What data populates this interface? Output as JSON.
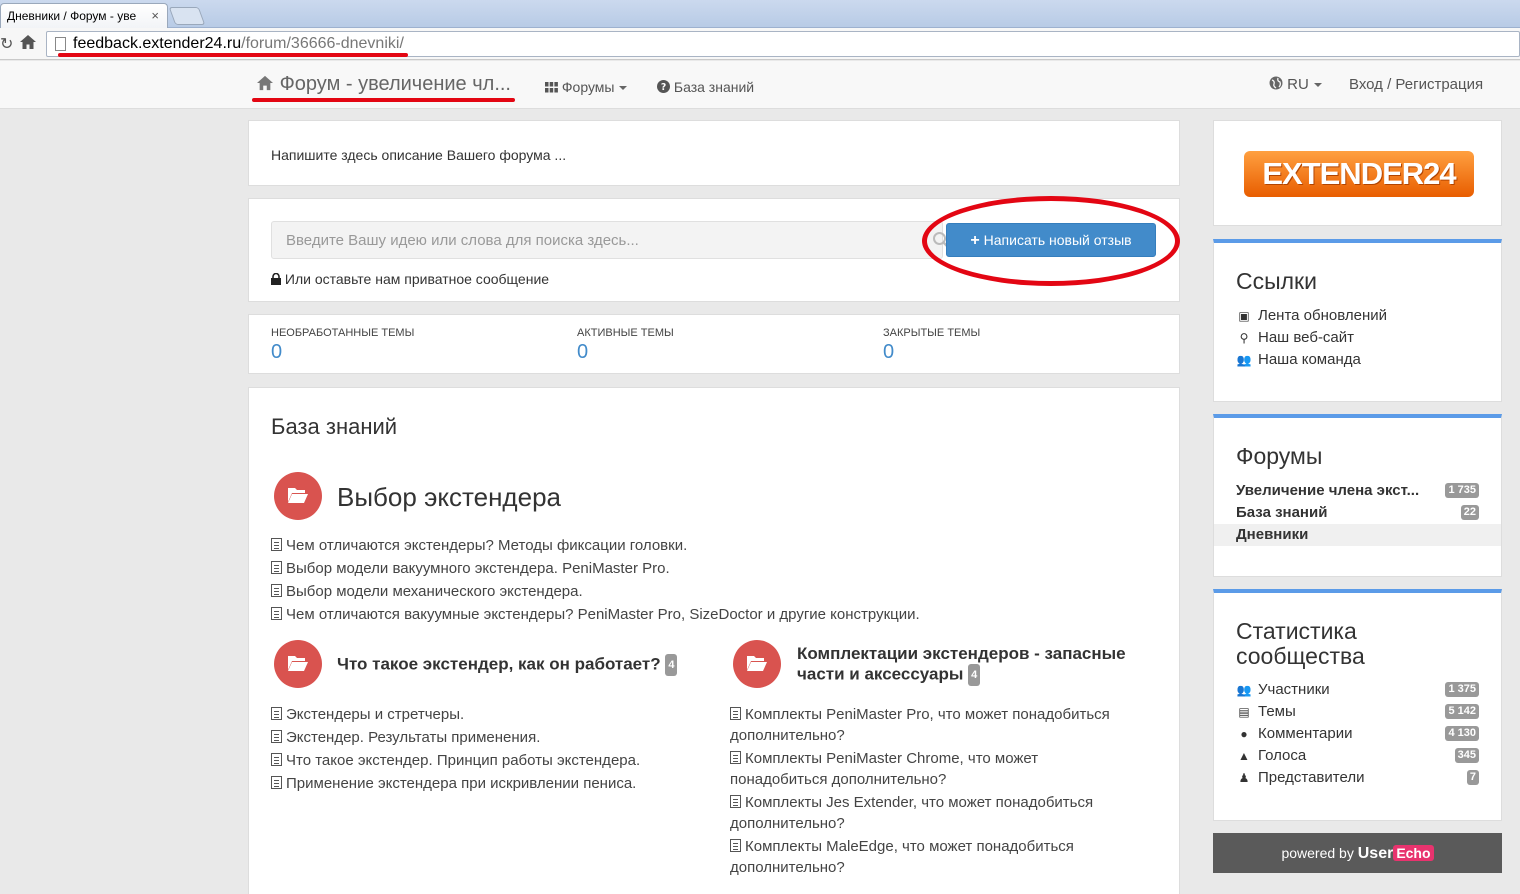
{
  "browser": {
    "tab_title": "Дневники / Форум - уве",
    "tab_close": "×",
    "url_domain": "feedback.extender24.ru",
    "url_path": "/forum/36666-dnevniki/"
  },
  "navbar": {
    "brand": "Форум - увеличение чл...",
    "forums_label": "Форумы",
    "kb_label": "База знаний",
    "lang_label": "RU",
    "login_label": "Вход / Регистрация"
  },
  "description": "Напишите здесь описание Вашего форума ...",
  "search": {
    "placeholder": "Введите Вашу идею или слова для поиска здесь...",
    "button_label": "Написать новый отзыв",
    "private_label": "Или оставьте нам приватное сообщение"
  },
  "stats": [
    {
      "label": "Необработанные темы",
      "value": "0"
    },
    {
      "label": "Активные темы",
      "value": "0"
    },
    {
      "label": "Закрытые темы",
      "value": "0"
    }
  ],
  "kb": {
    "title": "База знаний",
    "cat1": {
      "title": "Выбор экстендера",
      "articles": [
        "Чем отличаются экстендеры? Методы фиксации головки.",
        "Выбор модели вакуумного экстендера. PeniMaster Pro.",
        "Выбор модели механического экстендера.",
        "Чем отличаются вакуумные экстендеры? PeniMaster Pro, SizeDoctor и другие конструкции."
      ]
    },
    "cat2": {
      "title": "Что такое экстендер, как он работает?",
      "count": "4",
      "articles": [
        "Экстендеры и стретчеры.",
        "Экстендер. Результаты применения.",
        "Что такое экстендер. Принцип работы экстендера.",
        "Применение экстендера при искривлении пениса."
      ]
    },
    "cat3": {
      "title_line1": "Комплектации экстендеров - запасные",
      "title_line2": "части и аксессуары",
      "count": "4",
      "articles": [
        {
          "l1": "Комплекты PeniMaster Pro, что может понадобиться",
          "l2": "дополнительно?"
        },
        {
          "l1": "Комплекты PeniMaster Chrome, что может",
          "l2": "понадобиться дополнительно?"
        },
        {
          "l1": "Комплекты Jes Extender, что может понадобиться",
          "l2": "дополнительно?"
        },
        {
          "l1": "Комплекты MaleEdge, что может понадобиться",
          "l2": "дополнительно?"
        }
      ]
    }
  },
  "sidebar": {
    "logo_text": "EXTENDER24",
    "links_title": "Ссылки",
    "links": [
      "Лента обновлений",
      "Наш веб-сайт",
      "Наша команда"
    ],
    "forums_title": "Форумы",
    "forums": [
      {
        "label": "Увеличение члена экст...",
        "count": "1 735"
      },
      {
        "label": "База знаний",
        "count": "22"
      },
      {
        "label": "Дневники",
        "count": ""
      }
    ],
    "stats_title_line1": "Статистика",
    "stats_title_line2": "сообщества",
    "stats": [
      {
        "label": "Участники",
        "count": "1 375"
      },
      {
        "label": "Темы",
        "count": "5 142"
      },
      {
        "label": "Комментарии",
        "count": "4 130"
      },
      {
        "label": "Голоса",
        "count": "345"
      },
      {
        "label": "Представители",
        "count": "7"
      }
    ]
  },
  "powered": {
    "prefix": "powered by",
    "user": "User",
    "echo": "Echo"
  },
  "colors": {
    "primary": "#428bca",
    "category": "#d9534f",
    "annotation": "#e30613",
    "sidebar_accent": "#5b9be8"
  }
}
